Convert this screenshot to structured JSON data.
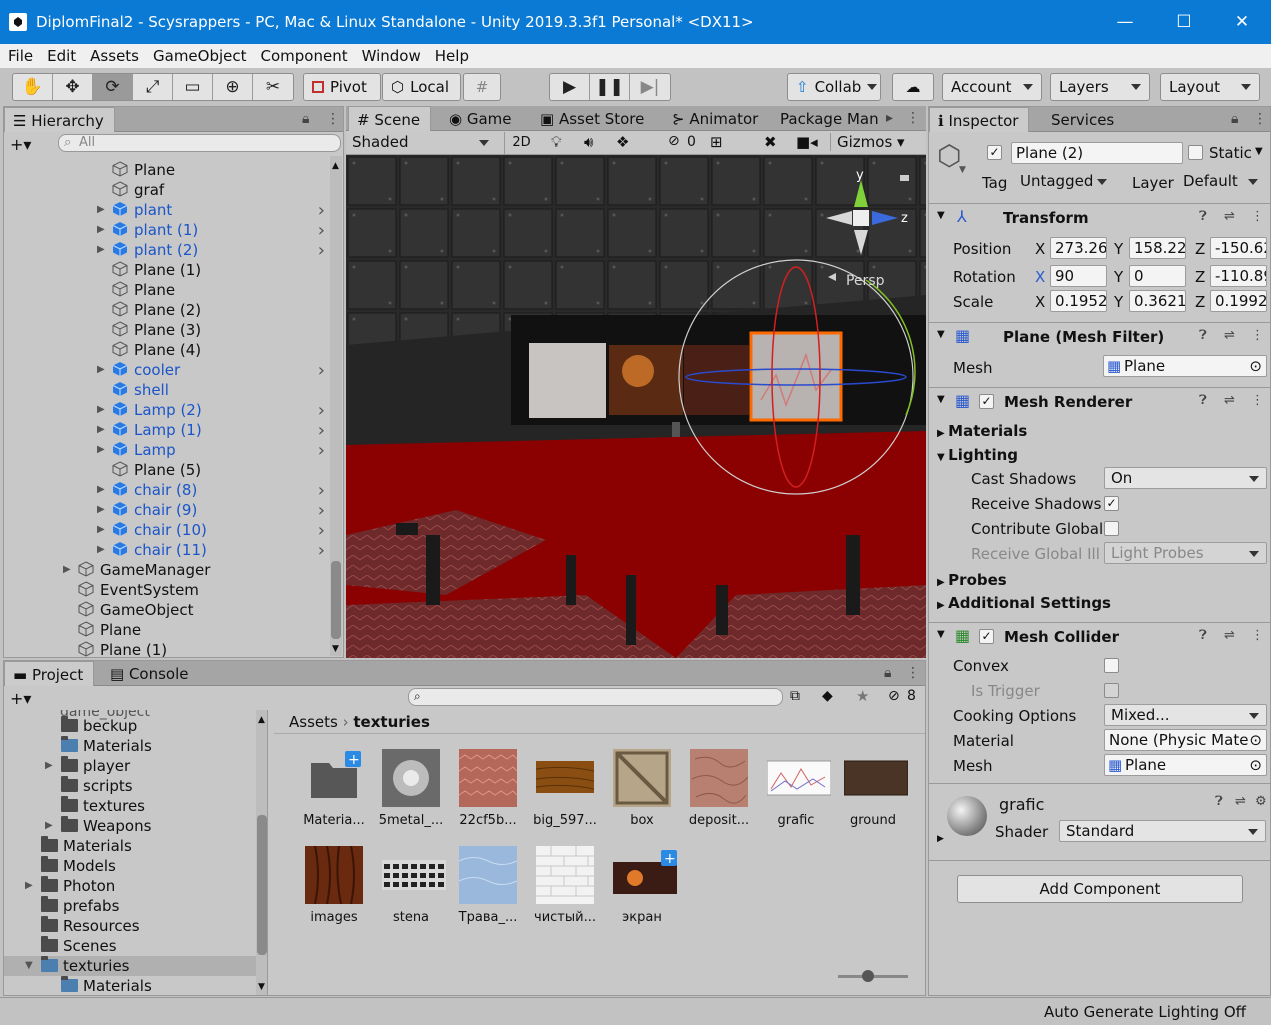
{
  "window": {
    "title": "DiplomFinal2 - Scysrappers - PC, Mac & Linux Standalone - Unity 2019.3.3f1 Personal* <DX11>",
    "minimize": "—",
    "maximize": "☐",
    "close": "✕"
  },
  "menu": [
    "File",
    "Edit",
    "Assets",
    "GameObject",
    "Component",
    "Window",
    "Help"
  ],
  "toolbar": {
    "pivot": "Pivot",
    "local": "Local",
    "collab": "Collab",
    "account": "Account",
    "layers": "Layers",
    "layout": "Layout"
  },
  "hierarchy": {
    "tab": "Hierarchy",
    "search_placeholder": "All",
    "items": [
      {
        "label": "Plane",
        "prefab": false,
        "expandable": false,
        "indent": 1
      },
      {
        "label": "graf",
        "prefab": false,
        "expandable": false,
        "indent": 1
      },
      {
        "label": "plant",
        "prefab": true,
        "expandable": true,
        "indent": 1
      },
      {
        "label": "plant (1)",
        "prefab": true,
        "expandable": true,
        "indent": 1
      },
      {
        "label": "plant (2)",
        "prefab": true,
        "expandable": true,
        "indent": 1
      },
      {
        "label": "Plane (1)",
        "prefab": false,
        "expandable": false,
        "indent": 1
      },
      {
        "label": "Plane",
        "prefab": false,
        "expandable": false,
        "indent": 1
      },
      {
        "label": "Plane (2)",
        "prefab": false,
        "expandable": false,
        "indent": 1
      },
      {
        "label": "Plane (3)",
        "prefab": false,
        "expandable": false,
        "indent": 1
      },
      {
        "label": "Plane (4)",
        "prefab": false,
        "expandable": false,
        "indent": 1
      },
      {
        "label": "cooler",
        "prefab": true,
        "expandable": true,
        "indent": 1
      },
      {
        "label": "shell",
        "prefab": true,
        "expandable": false,
        "indent": 1
      },
      {
        "label": "Lamp (2)",
        "prefab": true,
        "expandable": true,
        "indent": 1
      },
      {
        "label": "Lamp (1)",
        "prefab": true,
        "expandable": true,
        "indent": 1
      },
      {
        "label": "Lamp",
        "prefab": true,
        "expandable": true,
        "indent": 1
      },
      {
        "label": "Plane (5)",
        "prefab": false,
        "expandable": false,
        "indent": 1
      },
      {
        "label": "chair (8)",
        "prefab": true,
        "expandable": true,
        "indent": 1
      },
      {
        "label": "chair (9)",
        "prefab": true,
        "expandable": true,
        "indent": 1
      },
      {
        "label": "chair (10)",
        "prefab": true,
        "expandable": true,
        "indent": 1
      },
      {
        "label": "chair (11)",
        "prefab": true,
        "expandable": true,
        "indent": 1
      },
      {
        "label": "GameManager",
        "prefab": false,
        "expandable": true,
        "indent": 0
      },
      {
        "label": "EventSystem",
        "prefab": false,
        "expandable": false,
        "indent": 0
      },
      {
        "label": "GameObject",
        "prefab": false,
        "expandable": false,
        "indent": 0
      },
      {
        "label": "Plane",
        "prefab": false,
        "expandable": false,
        "indent": 0
      },
      {
        "label": "Plane (1)",
        "prefab": false,
        "expandable": false,
        "indent": 0
      }
    ]
  },
  "scene": {
    "tabs": [
      "Scene",
      "Game",
      "Asset Store",
      "Animator",
      "Package Man"
    ],
    "shading": "Shaded",
    "mode2d": "2D",
    "hidden_count": "0",
    "gizmos": "Gizmos",
    "persp": "Persp",
    "axis_y": "y",
    "axis_z": "z"
  },
  "inspector": {
    "tabs": [
      "Inspector",
      "Services"
    ],
    "object_name": "Plane (2)",
    "static_label": "Static",
    "tag_label": "Tag",
    "tag_value": "Untagged",
    "layer_label": "Layer",
    "layer_value": "Default",
    "transform": {
      "title": "Transform",
      "position_label": "Position",
      "rotation_label": "Rotation",
      "scale_label": "Scale",
      "x": "X",
      "y": "Y",
      "z": "Z",
      "pos": [
        "273.267",
        "158.222",
        "-150.62"
      ],
      "rot": [
        "90",
        "0",
        "-110.89"
      ],
      "scl": [
        "0.19525",
        "0.36214",
        "0.19920"
      ]
    },
    "mesh_filter": {
      "title": "Plane (Mesh Filter)",
      "mesh_label": "Mesh",
      "mesh_value": "Plane"
    },
    "mesh_renderer": {
      "title": "Mesh Renderer",
      "materials": "Materials",
      "lighting": "Lighting",
      "cast_shadows_label": "Cast Shadows",
      "cast_shadows_value": "On",
      "receive_shadows_label": "Receive Shadows",
      "contribute_global_label": "Contribute Global",
      "receive_gi_label": "Receive Global Illu",
      "receive_gi_value": "Light Probes",
      "probes": "Probes",
      "additional": "Additional Settings"
    },
    "mesh_collider": {
      "title": "Mesh Collider",
      "convex_label": "Convex",
      "trigger_label": "Is Trigger",
      "cooking_label": "Cooking Options",
      "cooking_value": "Mixed...",
      "material_label": "Material",
      "material_value": "None (Physic Mate",
      "mesh_label": "Mesh",
      "mesh_value": "Plane"
    },
    "material": {
      "name": "grafic",
      "shader_label": "Shader",
      "shader_value": "Standard"
    },
    "add_component": "Add Component"
  },
  "project": {
    "tabs": [
      "Project",
      "Console"
    ],
    "hidden_count": "8",
    "breadcrumb": [
      "Assets",
      "texturies"
    ],
    "tree": [
      {
        "label": "beckup",
        "indent": 2,
        "arrow": false,
        "special": false
      },
      {
        "label": "Materials",
        "indent": 2,
        "arrow": false,
        "special": true
      },
      {
        "label": "player",
        "indent": 2,
        "arrow": true,
        "special": false
      },
      {
        "label": "scripts",
        "indent": 2,
        "arrow": false,
        "special": false
      },
      {
        "label": "textures",
        "indent": 2,
        "arrow": false,
        "special": false
      },
      {
        "label": "Weapons",
        "indent": 2,
        "arrow": true,
        "special": false
      },
      {
        "label": "Materials",
        "indent": 1,
        "arrow": false,
        "special": false
      },
      {
        "label": "Models",
        "indent": 1,
        "arrow": false,
        "special": false
      },
      {
        "label": "Photon",
        "indent": 1,
        "arrow": true,
        "special": false
      },
      {
        "label": "prefabs",
        "indent": 1,
        "arrow": false,
        "special": false
      },
      {
        "label": "Resources",
        "indent": 1,
        "arrow": false,
        "special": false
      },
      {
        "label": "Scenes",
        "indent": 1,
        "arrow": false,
        "special": false
      },
      {
        "label": "texturies",
        "indent": 1,
        "arrow": true,
        "special": true,
        "selected": true
      },
      {
        "label": "Materials",
        "indent": 2,
        "arrow": false,
        "special": true
      }
    ],
    "assets": [
      {
        "label": "Materia...",
        "thumb": "folder"
      },
      {
        "label": "5metal_...",
        "thumb": "metal"
      },
      {
        "label": "22cf5b...",
        "thumb": "redwave"
      },
      {
        "label": "big_597...",
        "thumb": "wood"
      },
      {
        "label": "box",
        "thumb": "crate"
      },
      {
        "label": "deposit...",
        "thumb": "leather"
      },
      {
        "label": "grafic",
        "thumb": "graph"
      },
      {
        "label": "ground",
        "thumb": "ground"
      },
      {
        "label": "images",
        "thumb": "woodgrain"
      },
      {
        "label": "stena",
        "thumb": "grid"
      },
      {
        "label": "Трава_...",
        "thumb": "blue"
      },
      {
        "label": "чистый...",
        "thumb": "brick"
      },
      {
        "label": "экран",
        "thumb": "screen"
      }
    ]
  },
  "status": {
    "text": "Auto Generate Lighting Off"
  }
}
